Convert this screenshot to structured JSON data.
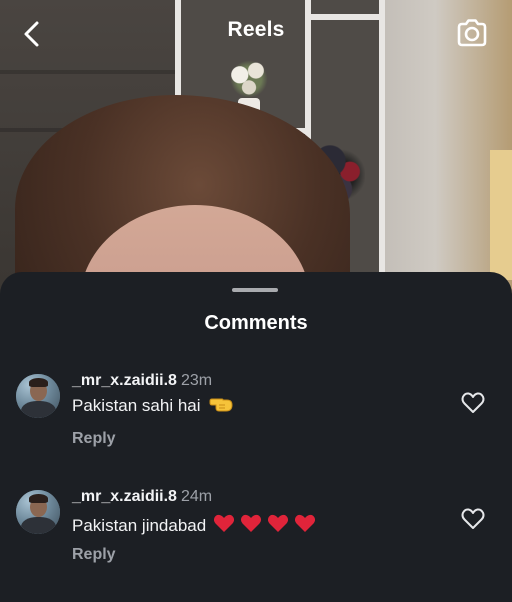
{
  "header": {
    "title": "Reels"
  },
  "sheet": {
    "title": "Comments"
  },
  "comments": [
    {
      "username": "_mr_x.zaidii.8",
      "time": "23m",
      "text": "Pakistan sahi hai",
      "emoji": "backhand-index-pointing-left",
      "reply_label": "Reply"
    },
    {
      "username": "_mr_x.zaidii.8",
      "time": "24m",
      "text": "Pakistan jindabad",
      "emoji": "red-heart-x4",
      "reply_label": "Reply"
    }
  ],
  "colors": {
    "sheet_bg": "#1c1f24",
    "text_primary": "#f2f3f5",
    "text_secondary": "#9da1a8",
    "heart_red": "#e0243a"
  }
}
